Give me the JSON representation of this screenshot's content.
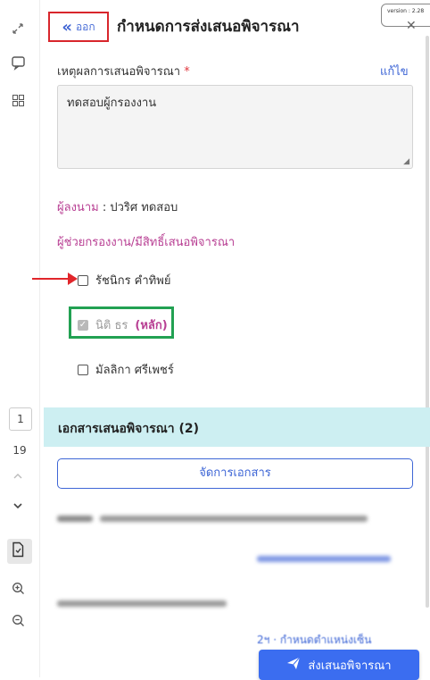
{
  "header": {
    "back_label": "ออก",
    "back_icon": "double-chevron-left-icon",
    "title": "กำหนดการส่งเสนอพิจารณา",
    "version": "version : 2.28"
  },
  "left_rail": {
    "page_current": "1",
    "page_total": "19",
    "icons": [
      "expand-icon",
      "comment-icon",
      "grid-icon",
      "chevron-up-icon",
      "chevron-down-icon",
      "document-sign-icon",
      "zoom-in-icon",
      "zoom-out-icon"
    ]
  },
  "reason": {
    "label": "เหตุผลการเสนอพิจารณา",
    "required_mark": "*",
    "edit_label": "แก้ไข",
    "value": "ทดสอบผู้กรองงาน"
  },
  "signer": {
    "key": "ผู้ลงนาม",
    "separator": " : ",
    "value": "ปวริศ ทดสอบ"
  },
  "helpers": {
    "label": "ผู้ช่วยกรองงาน/มีสิทธิ์เสนอพิจารณา",
    "items": [
      {
        "name": "รัชนิกร คำทิพย์",
        "checked": false,
        "disabled": false
      },
      {
        "name": "นิติ ธร",
        "tag": "(หลัก)",
        "checked": true,
        "disabled": true
      },
      {
        "name": "มัลลิกา ศรีเพชร์",
        "checked": false,
        "disabled": false
      }
    ]
  },
  "documents": {
    "header": "เอกสารเสนอพิจารณา (2)",
    "manage_label": "จัดการเอกสาร",
    "partial_link": "2ฯ · กำหนดตำแหน่งเซ็น"
  },
  "footer": {
    "send_label": "ส่งเสนอพิจารณา",
    "send_icon": "paper-plane-icon"
  },
  "colors": {
    "accent": "#3e66d6",
    "magenta": "#b83f93",
    "annotation_red": "#d8262c",
    "annotation_green": "#22a152",
    "doc_header_bg": "#cdeff2",
    "send_bg": "#3b6df0"
  }
}
